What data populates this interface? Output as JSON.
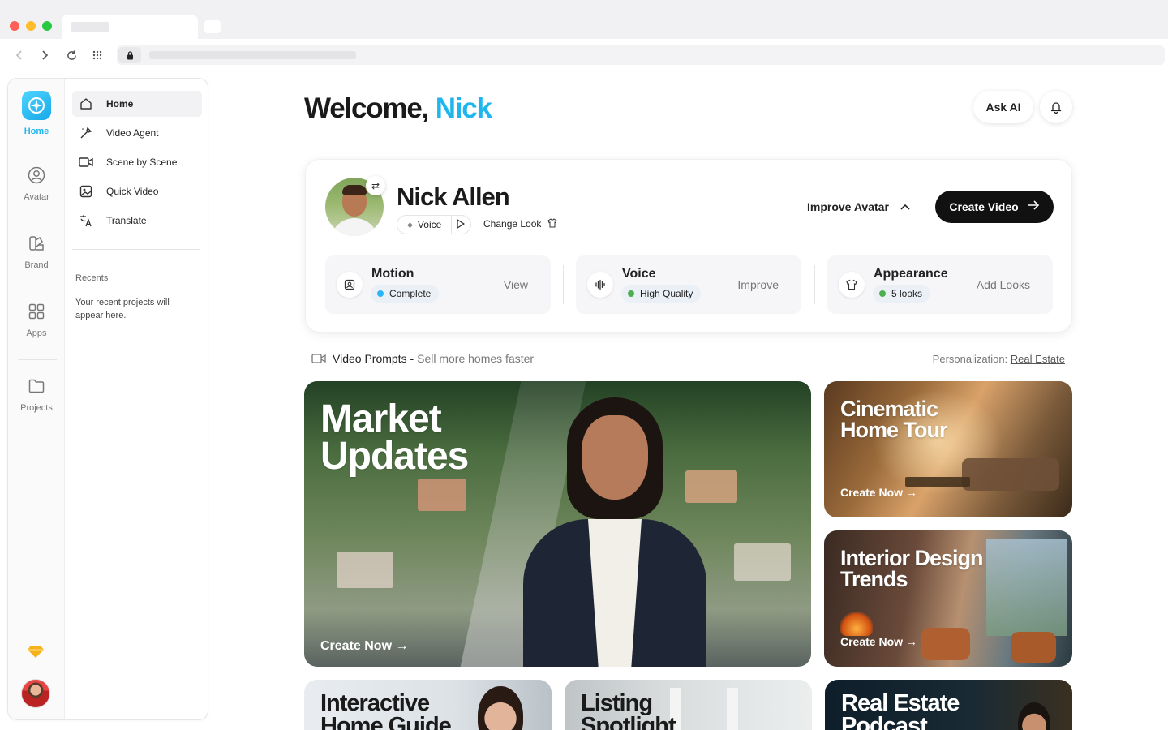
{
  "sidebar": {
    "rail": [
      {
        "label": "Home",
        "icon": "logo-icon",
        "active": true
      },
      {
        "label": "Avatar",
        "icon": "avatar-icon"
      },
      {
        "label": "Brand",
        "icon": "brand-icon"
      },
      {
        "label": "Apps",
        "icon": "apps-grid-icon"
      },
      {
        "label": "Projects",
        "icon": "folder-icon"
      }
    ],
    "menu": [
      {
        "label": "Home",
        "icon": "home-icon",
        "active": true
      },
      {
        "label": "Video Agent",
        "icon": "wand-icon"
      },
      {
        "label": "Scene by Scene",
        "icon": "video-camera-icon"
      },
      {
        "label": "Quick Video",
        "icon": "image-icon"
      },
      {
        "label": "Translate",
        "icon": "translate-icon"
      }
    ],
    "recents_title": "Recents",
    "recents_note": "Your recent projects will appear here."
  },
  "header": {
    "welcome_prefix": "Welcome,",
    "welcome_name": "Nick",
    "ask_ai": "Ask AI"
  },
  "profile": {
    "name": "Nick Allen",
    "voice": "Voice",
    "change_look": "Change Look",
    "improve_avatar": "Improve Avatar",
    "create_video": "Create Video",
    "stats": [
      {
        "title": "Motion",
        "badge": "Complete",
        "badge_color": "#29b6f6",
        "action": "View",
        "icon": "motion-icon"
      },
      {
        "title": "Voice",
        "badge": "High Quality",
        "badge_color": "#4caf50",
        "action": "Improve",
        "icon": "audio-wave-icon"
      },
      {
        "title": "Appearance",
        "badge": "5 looks",
        "badge_color": "#4caf50",
        "action": "Add Looks",
        "icon": "shirt-icon"
      }
    ]
  },
  "prompts": {
    "title": "Video Prompts -",
    "subtitle": "Sell more homes faster",
    "personalization_label": "Personalization:",
    "personalization_value": "Real Estate"
  },
  "tiles": [
    {
      "title_line1": "Market",
      "title_line2": "Updates",
      "cta": "Create Now →"
    },
    {
      "title_line1": "Cinematic",
      "title_line2": "Home Tour",
      "cta": "Create Now →"
    },
    {
      "title_line1": "Interior Design",
      "title_line2": "Trends",
      "cta": "Create Now →"
    },
    {
      "title_line1": "Interactive",
      "title_line2": "Home Guide"
    },
    {
      "title_line1": "Listing",
      "title_line2": "Spotlight"
    },
    {
      "title_line1": "Real Estate",
      "title_line2": "Podcast"
    }
  ],
  "colors": {
    "accent": "#1fb6ee",
    "dark_button": "#111111"
  }
}
